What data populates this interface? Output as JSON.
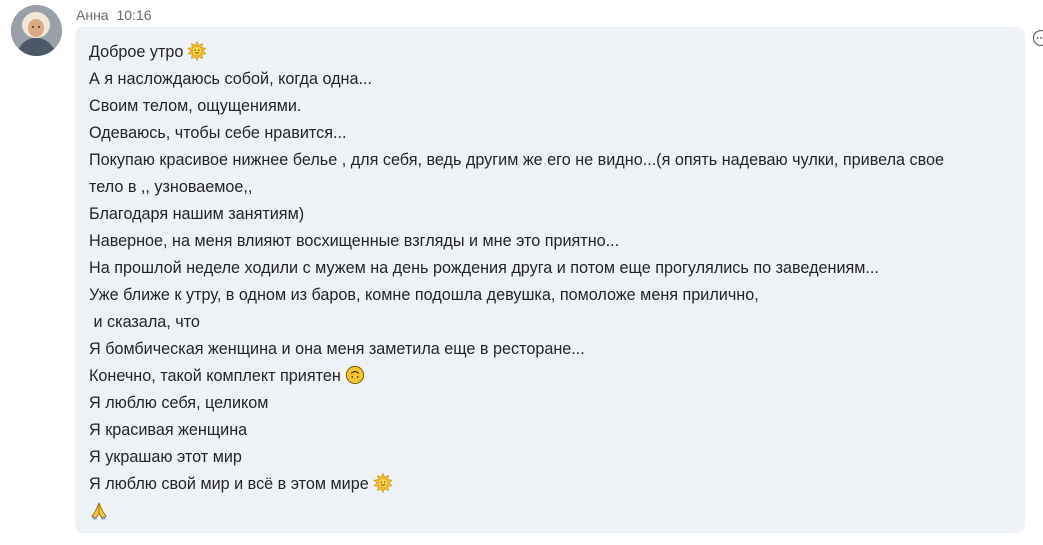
{
  "message": {
    "sender": "Анна",
    "time": "10:16",
    "lines": [
      {
        "text": "Доброе утро",
        "emoji": "sun-face-icon"
      },
      {
        "text": "А я наслождаюсь собой, когда одна..."
      },
      {
        "text": "Своим телом, ощущениями."
      },
      {
        "text": "Одеваюсь, чтобы себе нравится..."
      },
      {
        "text": "Покупаю красивое нижнее белье , для себя, ведь другим же его не видно...(я опять надеваю чулки, привела свое"
      },
      {
        "text": "тело в ,, узноваемое,,"
      },
      {
        "text": "Благодаря нашим занятиям)"
      },
      {
        "text": "Наверное, на меня влияют восхищенные взгляды и мне это приятно..."
      },
      {
        "text": "На прошлой неделе ходили с мужем на день рождения друга и потом еще прогулялись по заведениям..."
      },
      {
        "text": "Уже ближе к утру, в одном из баров, комне подошла девушка, помоложе меня прилично,"
      },
      {
        "text": " и сказала, что"
      },
      {
        "text": "Я бомбическая женщина и она меня заметила еще в ресторане..."
      },
      {
        "text": "Конечно, такой комплект приятен",
        "emoji": "upside-down-face-icon"
      },
      {
        "text": "Я люблю себя, целиком"
      },
      {
        "text": "Я красивая женщина"
      },
      {
        "text": "Я украшаю этот мир"
      },
      {
        "text": "Я люблю свой мир и всё в этом мире",
        "emoji": "sun-face-icon"
      },
      {
        "text": "",
        "emoji": "folded-hands-icon"
      }
    ]
  },
  "icons": {
    "avatar": "avatar-photo",
    "more": "more-options-icon"
  },
  "colors": {
    "bubble_bg": "#eef2f7",
    "meta_text": "#6b6b6b",
    "body_text": "#242424",
    "emoji_yellow": "#f7c531"
  }
}
